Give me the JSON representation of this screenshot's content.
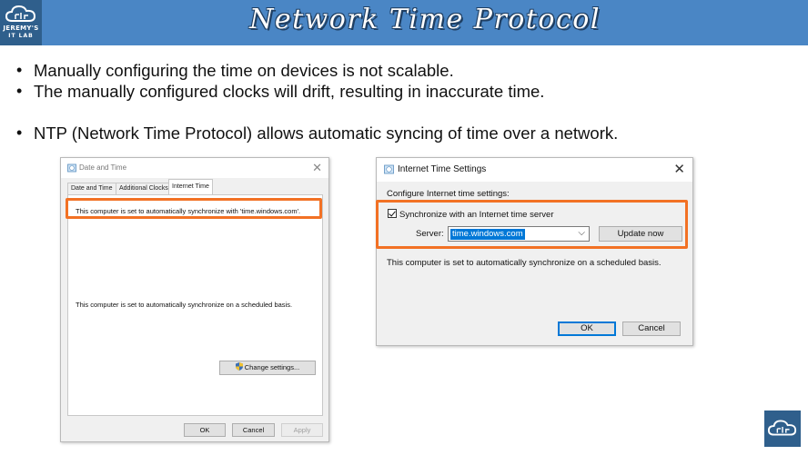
{
  "slide": {
    "title": "Network Time Protocol",
    "logo": {
      "line1": "JEREMY'S",
      "line2": "IT LAB",
      "icon": "cloud-logo-icon"
    },
    "bullets": [
      "Manually configuring the time on devices is not scalable.",
      "The manually configured clocks will drift, resulting in inaccurate time.",
      "NTP (Network Time Protocol) allows automatic syncing of time over a network."
    ],
    "highlight_color": "#f27124",
    "header_color": "#4a86c5"
  },
  "date_time_dialog": {
    "title": "Date and Time",
    "tabs": [
      "Date and Time",
      "Additional Clocks",
      "Internet Time"
    ],
    "active_tab": "Internet Time",
    "sync_text": "This computer is set to automatically synchronize with 'time.windows.com'.",
    "schedule_text": "This computer is set to automatically synchronize on a scheduled basis.",
    "change_settings_label": "Change settings...",
    "ok_label": "OK",
    "cancel_label": "Cancel",
    "apply_label": "Apply"
  },
  "internet_time_dialog": {
    "title": "Internet Time Settings",
    "configure_label": "Configure Internet time settings:",
    "sync_checkbox_label": "Synchronize with an Internet time server",
    "sync_checked": true,
    "server_label": "Server:",
    "server_value": "time.windows.com",
    "update_now_label": "Update now",
    "info_text": "This computer is set to automatically synchronize on a scheduled basis.",
    "ok_label": "OK",
    "cancel_label": "Cancel"
  }
}
